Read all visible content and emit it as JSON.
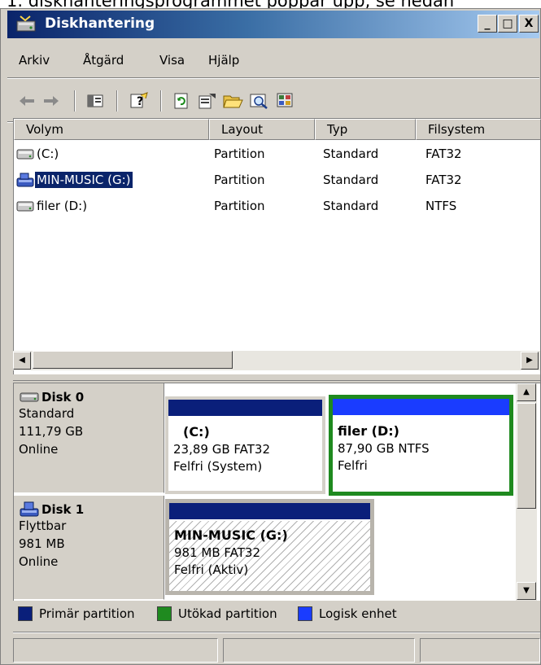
{
  "caption": "1. diskhanteringsprogrammet poppar upp, se nedan",
  "window": {
    "title": "Diskhantering",
    "controls": {
      "minimize": "_",
      "maximize": "□",
      "close": "X"
    }
  },
  "menu": [
    "Arkiv",
    "Åtgärd",
    "Visa",
    "Hjälp"
  ],
  "toolbar": {
    "icons": [
      "back-arrow-icon",
      "forward-arrow-icon",
      "show-hide-pane-icon",
      "help-icon",
      "refresh-icon",
      "properties-icon",
      "open-folder-icon",
      "search-icon",
      "console-icon"
    ]
  },
  "volume_list": {
    "columns": [
      "Volym",
      "Layout",
      "Typ",
      "Filsystem"
    ],
    "rows": [
      {
        "volume": "(C:)",
        "layout": "Partition",
        "type": "Standard",
        "filesystem": "FAT32",
        "icon": "disk-drive-icon",
        "selected": false
      },
      {
        "volume": "MIN-MUSIC (G:)",
        "layout": "Partition",
        "type": "Standard",
        "filesystem": "FAT32",
        "icon": "removable-drive-icon",
        "selected": true
      },
      {
        "volume": "filer (D:)",
        "layout": "Partition",
        "type": "Standard",
        "filesystem": "NTFS",
        "icon": "disk-drive-icon",
        "selected": false
      }
    ]
  },
  "disks": [
    {
      "name": "Disk 0",
      "type": "Standard",
      "size": "111,79 GB",
      "status": "Online",
      "icon": "hard-disk-icon",
      "partitions": [
        {
          "title": "(C:)",
          "info": "23,89 GB FAT32",
          "status": "Felfri (System)",
          "kind": "primary"
        },
        {
          "title": "filer  (D:)",
          "info": "87,90 GB NTFS",
          "status": "Felfri",
          "kind": "logical"
        }
      ]
    },
    {
      "name": "Disk 1",
      "type": "Flyttbar",
      "size": "981 MB",
      "status": "Online",
      "icon": "removable-disk-icon",
      "partitions": [
        {
          "title": "MIN-MUSIC  (G:)",
          "info": "981 MB FAT32",
          "status": "Felfri (Aktiv)",
          "kind": "primary"
        }
      ]
    }
  ],
  "legend": [
    {
      "label": "Primär partition",
      "color": "#0a1f7a"
    },
    {
      "label": "Utökad partition",
      "color": "#1f8a1f"
    },
    {
      "label": "Logisk enhet",
      "color": "#1a3cff"
    }
  ],
  "colors": {
    "primary": "#0a1f7a",
    "extended": "#1f8a1f",
    "logical": "#1a3cff",
    "selection": "#0a246a"
  }
}
